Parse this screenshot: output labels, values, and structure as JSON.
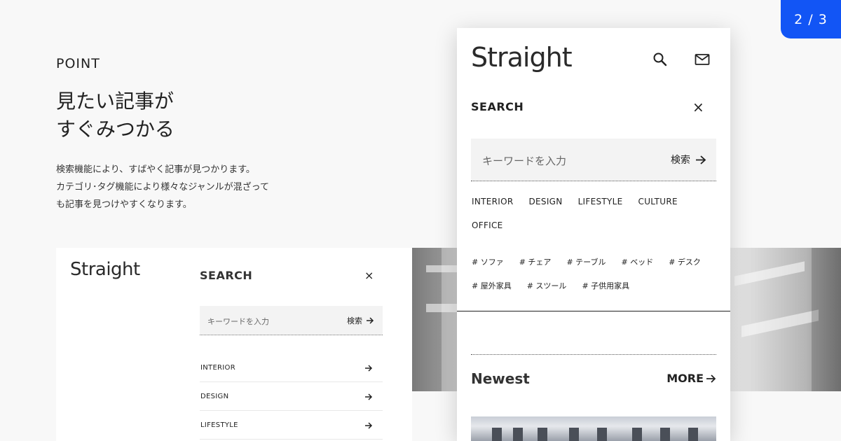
{
  "counter": "2 / 3",
  "intro": {
    "label": "POINT",
    "headline": [
      "見たい記事が",
      "すぐみつかる"
    ],
    "description": [
      "検索機能により、すばやく記事が見つかります。",
      "カテゴリ･タグ機能により様々なジャンルが混ざって",
      "も記事を見つけやすくなります。"
    ]
  },
  "desktop": {
    "logo": "Straight",
    "search_title": "SEARCH",
    "close": "×",
    "search_placeholder": "キーワードを入力",
    "search_button": "検索",
    "categories": [
      "INTERIOR",
      "DESIGN",
      "LIFESTYLE"
    ]
  },
  "phone": {
    "logo": "Straight",
    "search_title": "SEARCH",
    "close": "×",
    "search_placeholder": "キーワードを入力",
    "search_button": "検索",
    "categories": [
      "INTERIOR",
      "DESIGN",
      "LIFESTYLE",
      "CULTURE",
      "OFFICE"
    ],
    "tags": [
      "# ソファ",
      "# チェア",
      "# テーブル",
      "# ベッド",
      "# デスク",
      "# 屋外家具",
      "# スツール",
      "# 子供用家具"
    ],
    "newest_heading": "Newest",
    "more_label": "MORE"
  },
  "colors": {
    "accent": "#1255f5",
    "background": "#f8f8f8"
  }
}
